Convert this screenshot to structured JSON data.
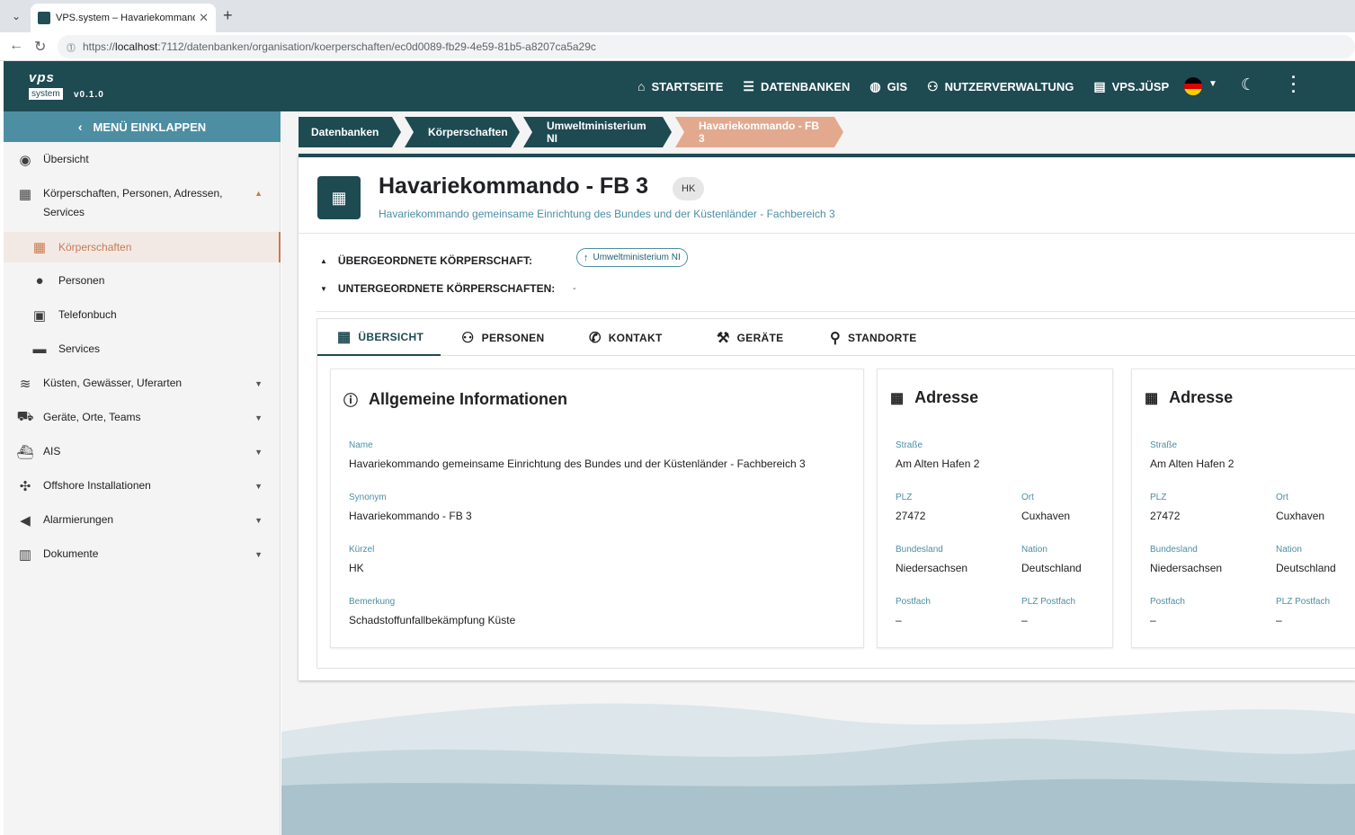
{
  "browser": {
    "tab_title": "VPS.system – Havariekommando g",
    "url_prefix": "https://",
    "url_host": "localhost",
    "url_rest": ":7112/datenbanken/organisation/koerperschaften/ec0d0089-fb29-4e59-81b5-a8207ca5a29c"
  },
  "app": {
    "logo_top": "vps",
    "logo_bottom": "system",
    "version": "v0.1.0",
    "nav": [
      {
        "label": "STARTSEITE",
        "icon": "home-icon"
      },
      {
        "label": "DATENBANKEN",
        "icon": "list-icon"
      },
      {
        "label": "GIS",
        "icon": "globe-icon"
      },
      {
        "label": "NUTZERVERWALTUNG",
        "icon": "people-icon"
      },
      {
        "label": "VPS.JÜSP",
        "icon": "document-icon"
      }
    ]
  },
  "sidebar": {
    "collapse_label": "MENÜ EINKLAPPEN",
    "items": [
      {
        "label": "Übersicht",
        "icon": "compass-icon"
      },
      {
        "label": "Körperschaften, Personen, Adressen, Services",
        "icon": "building-icon"
      },
      {
        "label": "Körperschaften",
        "icon": "building-icon"
      },
      {
        "label": "Personen",
        "icon": "person-icon"
      },
      {
        "label": "Telefonbuch",
        "icon": "contact-card-icon"
      },
      {
        "label": "Services",
        "icon": "briefcase-icon"
      },
      {
        "label": "Küsten, Gewässer, Uferarten",
        "icon": "waves-icon"
      },
      {
        "label": "Geräte, Orte, Teams",
        "icon": "truck-icon"
      },
      {
        "label": "AIS",
        "icon": "ship-icon"
      },
      {
        "label": "Offshore Installationen",
        "icon": "wind-turbine-icon"
      },
      {
        "label": "Alarmierungen",
        "icon": "megaphone-icon"
      },
      {
        "label": "Dokumente",
        "icon": "library-icon"
      }
    ]
  },
  "breadcrumb": [
    "Datenbanken",
    "Körperschaften",
    "Umweltministerium NI",
    "Havariekommando - FB 3"
  ],
  "entity": {
    "title": "Havariekommando - FB 3",
    "chip": "HK",
    "subtitle": "Havariekommando gemeinsame Einrichtung des Bundes und der Küstenländer - Fachbereich 3",
    "parent_label": "ÜBERGEORDNETE KÖRPERSCHAFT:",
    "parent_value": "Umweltministerium NI",
    "children_label": "UNTERGEORDNETE KÖRPERSCHAFTEN:",
    "children_value": "-"
  },
  "tabs": [
    {
      "label": "ÜBERSICHT",
      "icon": "building-icon",
      "selected": true
    },
    {
      "label": "PERSONEN",
      "icon": "people-icon"
    },
    {
      "label": "KONTAKT",
      "icon": "phone-icon"
    },
    {
      "label": "GERÄTE",
      "icon": "tools-icon"
    },
    {
      "label": "STANDORTE",
      "icon": "location-pin-icon"
    }
  ],
  "info_card": {
    "title": "Allgemeine Informationen",
    "fields": [
      {
        "label": "Name",
        "value": "Havariekommando gemeinsame Einrichtung des Bundes und der Küstenländer - Fachbereich 3"
      },
      {
        "label": "Synonym",
        "value": "Havariekommando - FB 3"
      },
      {
        "label": "Kürzel",
        "value": "HK"
      },
      {
        "label": "Bemerkung",
        "value": "Schadstoffunfallbekämpfung Küste"
      }
    ]
  },
  "address_cards": [
    {
      "title": "Adresse",
      "strasse_label": "Straße",
      "strasse": "Am Alten Hafen 2",
      "plz_label": "PLZ",
      "plz": "27472",
      "ort_label": "Ort",
      "ort": "Cuxhaven",
      "bundesland_label": "Bundesland",
      "bundesland": "Niedersachsen",
      "nation_label": "Nation",
      "nation": "Deutschland",
      "postfach_label": "Postfach",
      "postfach": "–",
      "plzpostfach_label": "PLZ Postfach",
      "plzpostfach": "–"
    },
    {
      "title": "Adresse",
      "strasse_label": "Straße",
      "strasse": "Am Alten Hafen 2",
      "plz_label": "PLZ",
      "plz": "27472",
      "ort_label": "Ort",
      "ort": "Cuxhaven",
      "bundesland_label": "Bundesland",
      "bundesland": "Niedersachsen",
      "nation_label": "Nation",
      "nation": "Deutschland",
      "postfach_label": "Postfach",
      "postfach": "–",
      "plzpostfach_label": "PLZ Postfach",
      "plzpostfach": "–"
    }
  ],
  "colors": {
    "primary": "#1e4a52",
    "accent": "#c77a53",
    "link": "#4d8ea3"
  }
}
